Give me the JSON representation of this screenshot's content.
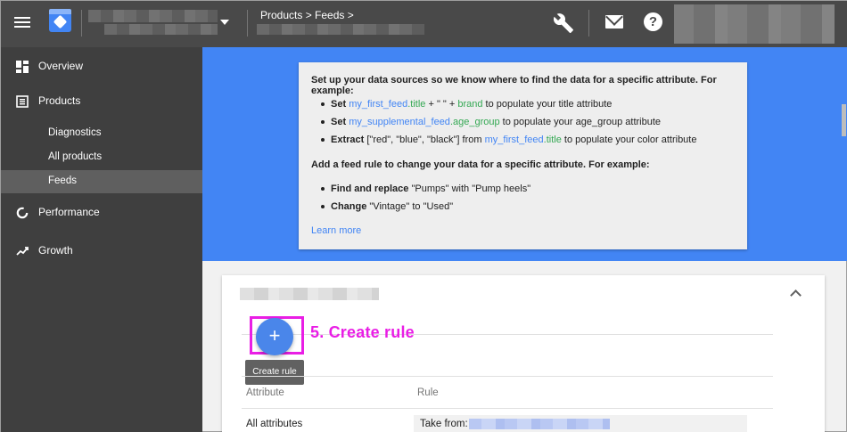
{
  "header": {
    "breadcrumb": "Products > Feeds >",
    "icons": [
      "menu-icon",
      "merchant-logo-icon",
      "dropdown-caret-icon",
      "wrench-icon",
      "mail-icon",
      "help-icon"
    ]
  },
  "sidebar": {
    "items": [
      {
        "label": "Overview",
        "icon": "overview-icon"
      },
      {
        "label": "Products",
        "icon": "products-icon"
      },
      {
        "label": "Diagnostics"
      },
      {
        "label": "All products"
      },
      {
        "label": "Feeds",
        "active": true
      },
      {
        "label": "Performance",
        "icon": "performance-icon"
      },
      {
        "label": "Growth",
        "icon": "growth-icon"
      }
    ]
  },
  "info": {
    "heading1": "Set up your data sources so we know where to find the data for a specific attribute. For example:",
    "b1": {
      "kw": "Set",
      "a": "my_first_feed",
      "b": ".title",
      "c": " + \" \" + ",
      "d": "brand",
      "e": " to populate your title attribute"
    },
    "b2": {
      "kw": "Set",
      "a": "my_supplemental_feed",
      "b": ".age_group",
      "e": " to populate your age_group attribute"
    },
    "b3": {
      "kw": "Extract",
      "pre": " [\"red\", \"blue\", \"black\"] from ",
      "a": "my_first_feed",
      "b": ".title",
      "e": " to populate your color attribute"
    },
    "heading2": "Add a feed rule to change your data for a specific attribute. For example:",
    "b4": {
      "kw": "Find and replace",
      "e": " \"Pumps\" with \"Pump heels\""
    },
    "b5": {
      "kw": "Change",
      "e": " \"Vintage\" to \"Used\""
    },
    "learn_more": "Learn more"
  },
  "rules": {
    "fab": "+",
    "annotation": "5. Create rule",
    "tooltip": "Create rule",
    "col_attribute": "Attribute",
    "col_rule": "Rule",
    "row_attribute": "All attributes",
    "row_rule_prefix": "Take from:"
  },
  "colors": {
    "topbar": "#494949",
    "sidebar": "#3f3f3f",
    "accent_blue": "#4285f4",
    "annotation_magenta": "#e91ee5",
    "link_green": "#34a853"
  }
}
